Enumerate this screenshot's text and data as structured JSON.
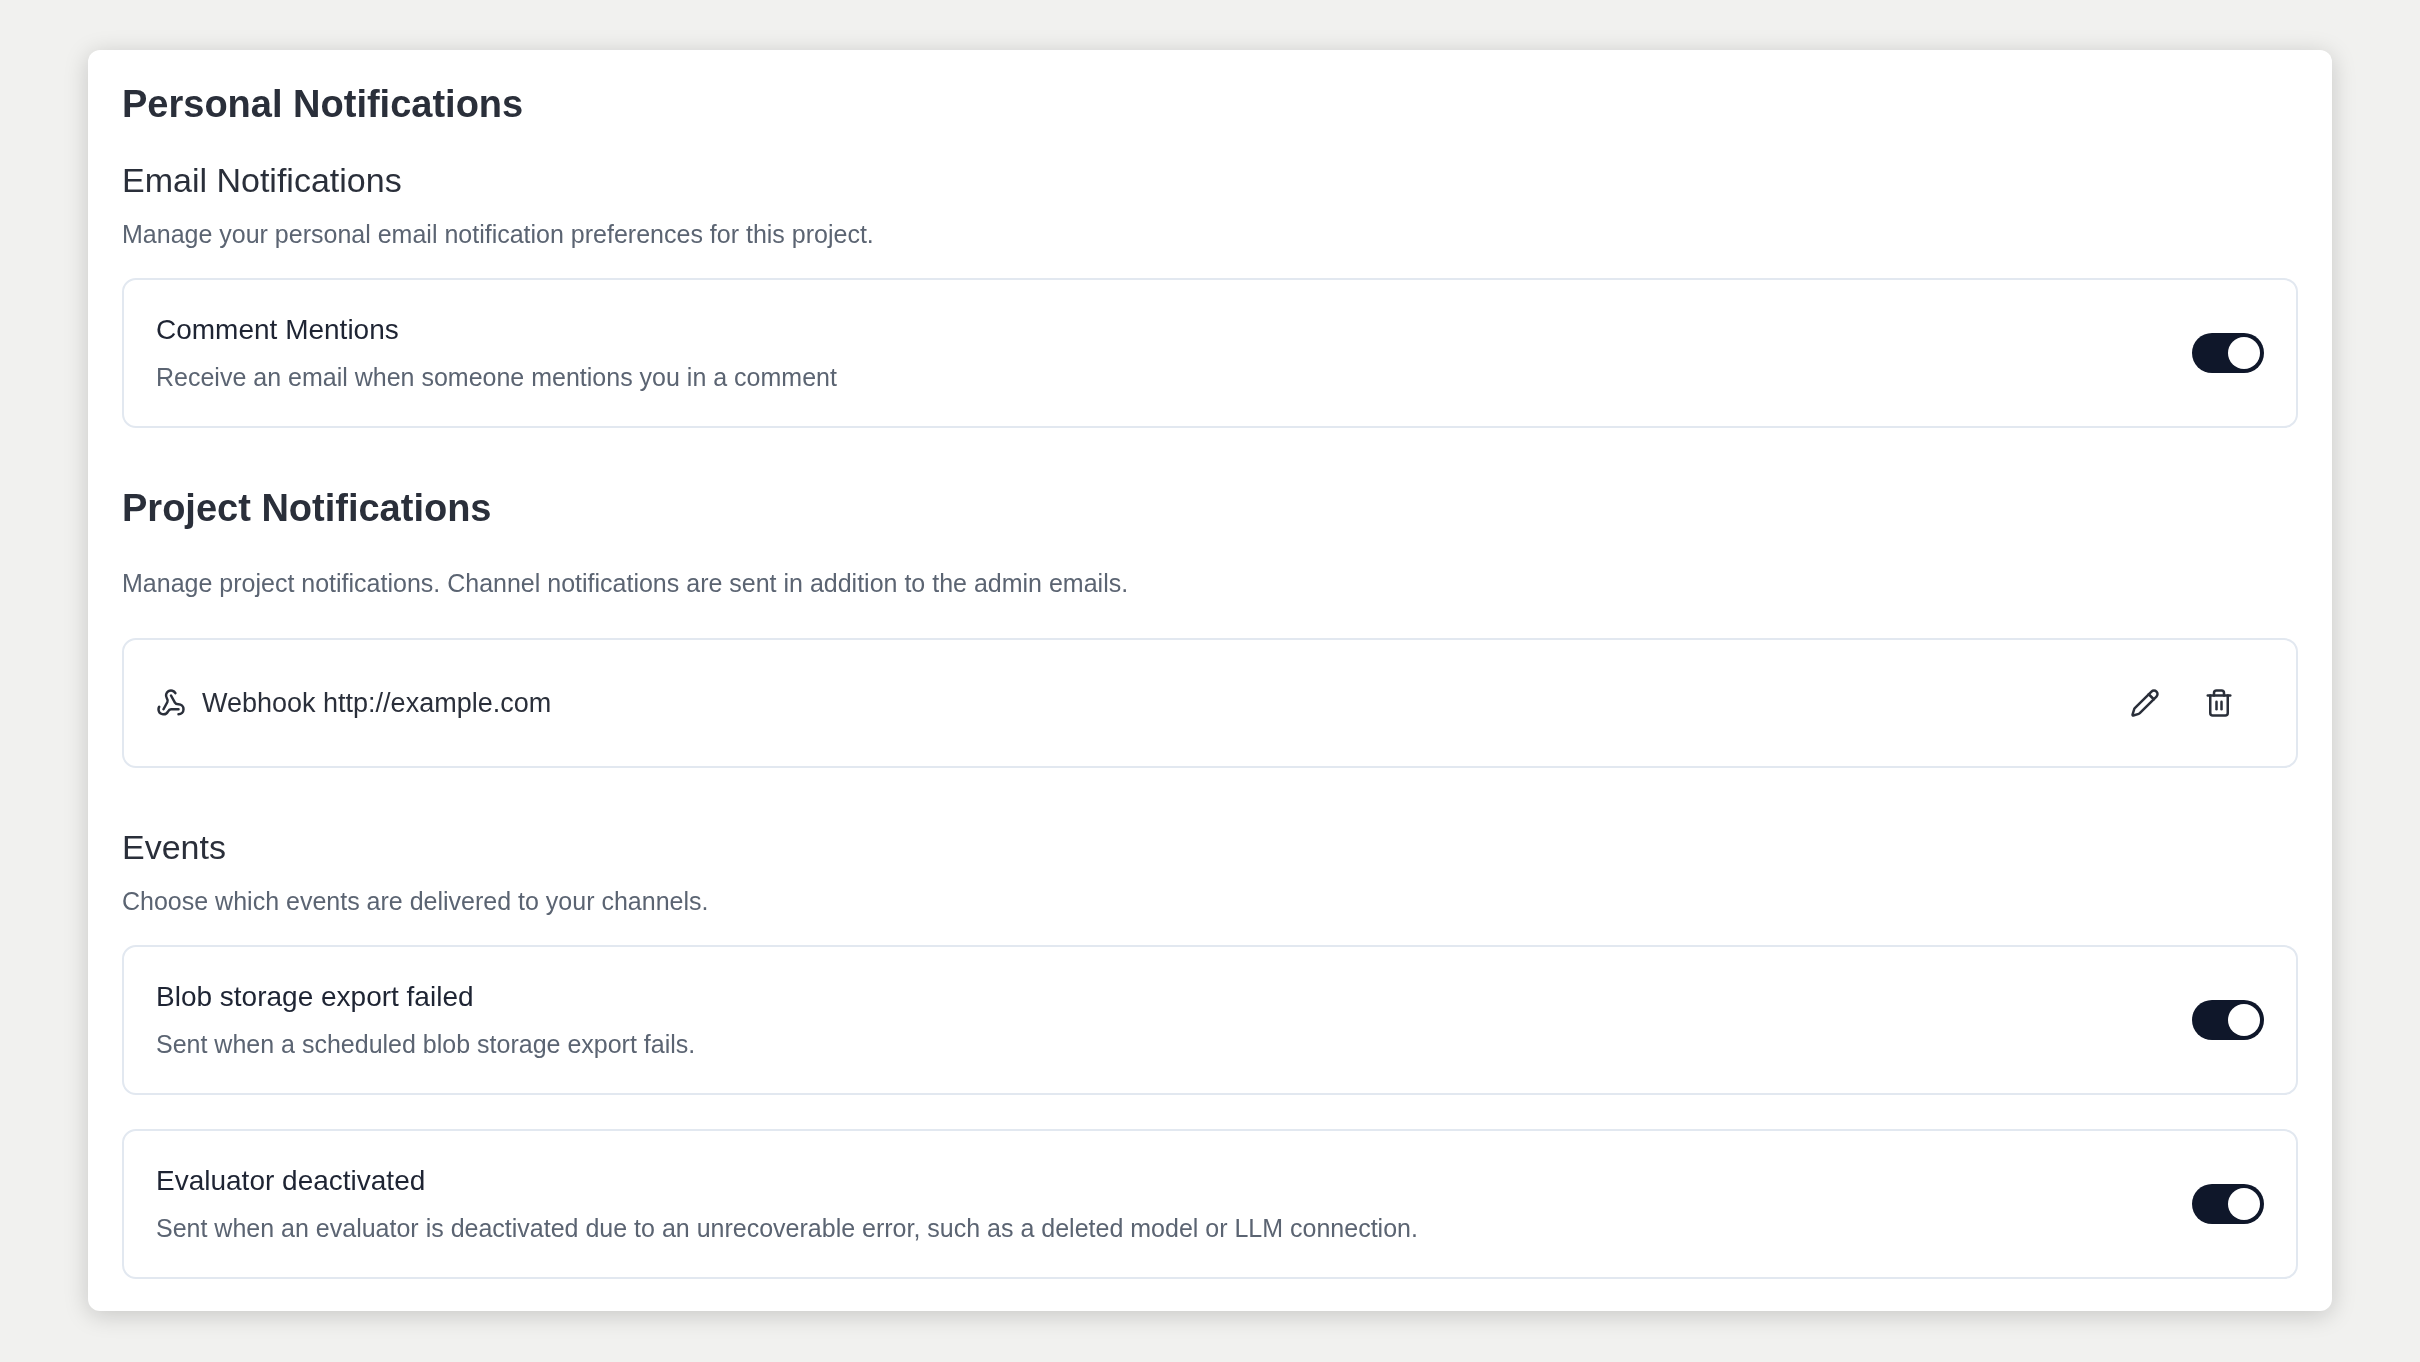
{
  "title": "Personal Notifications",
  "email": {
    "heading": "Email Notifications",
    "description": "Manage your personal email notification preferences for this project.",
    "items": [
      {
        "title": "Comment Mentions",
        "description": "Receive an email when someone mentions you in a comment",
        "on": true
      }
    ]
  },
  "project": {
    "heading": "Project Notifications",
    "description": "Manage project notifications. Channel notifications are sent in addition to the admin emails.",
    "channels": [
      {
        "label": "Webhook http://example.com"
      }
    ]
  },
  "events": {
    "heading": "Events",
    "description": "Choose which events are delivered to your channels.",
    "items": [
      {
        "title": "Blob storage export failed",
        "description": "Sent when a scheduled blob storage export fails.",
        "on": true
      },
      {
        "title": "Evaluator deactivated",
        "description": "Sent when an evaluator is deactivated due to an unrecoverable error, such as a deleted model or LLM connection.",
        "on": true
      }
    ]
  }
}
